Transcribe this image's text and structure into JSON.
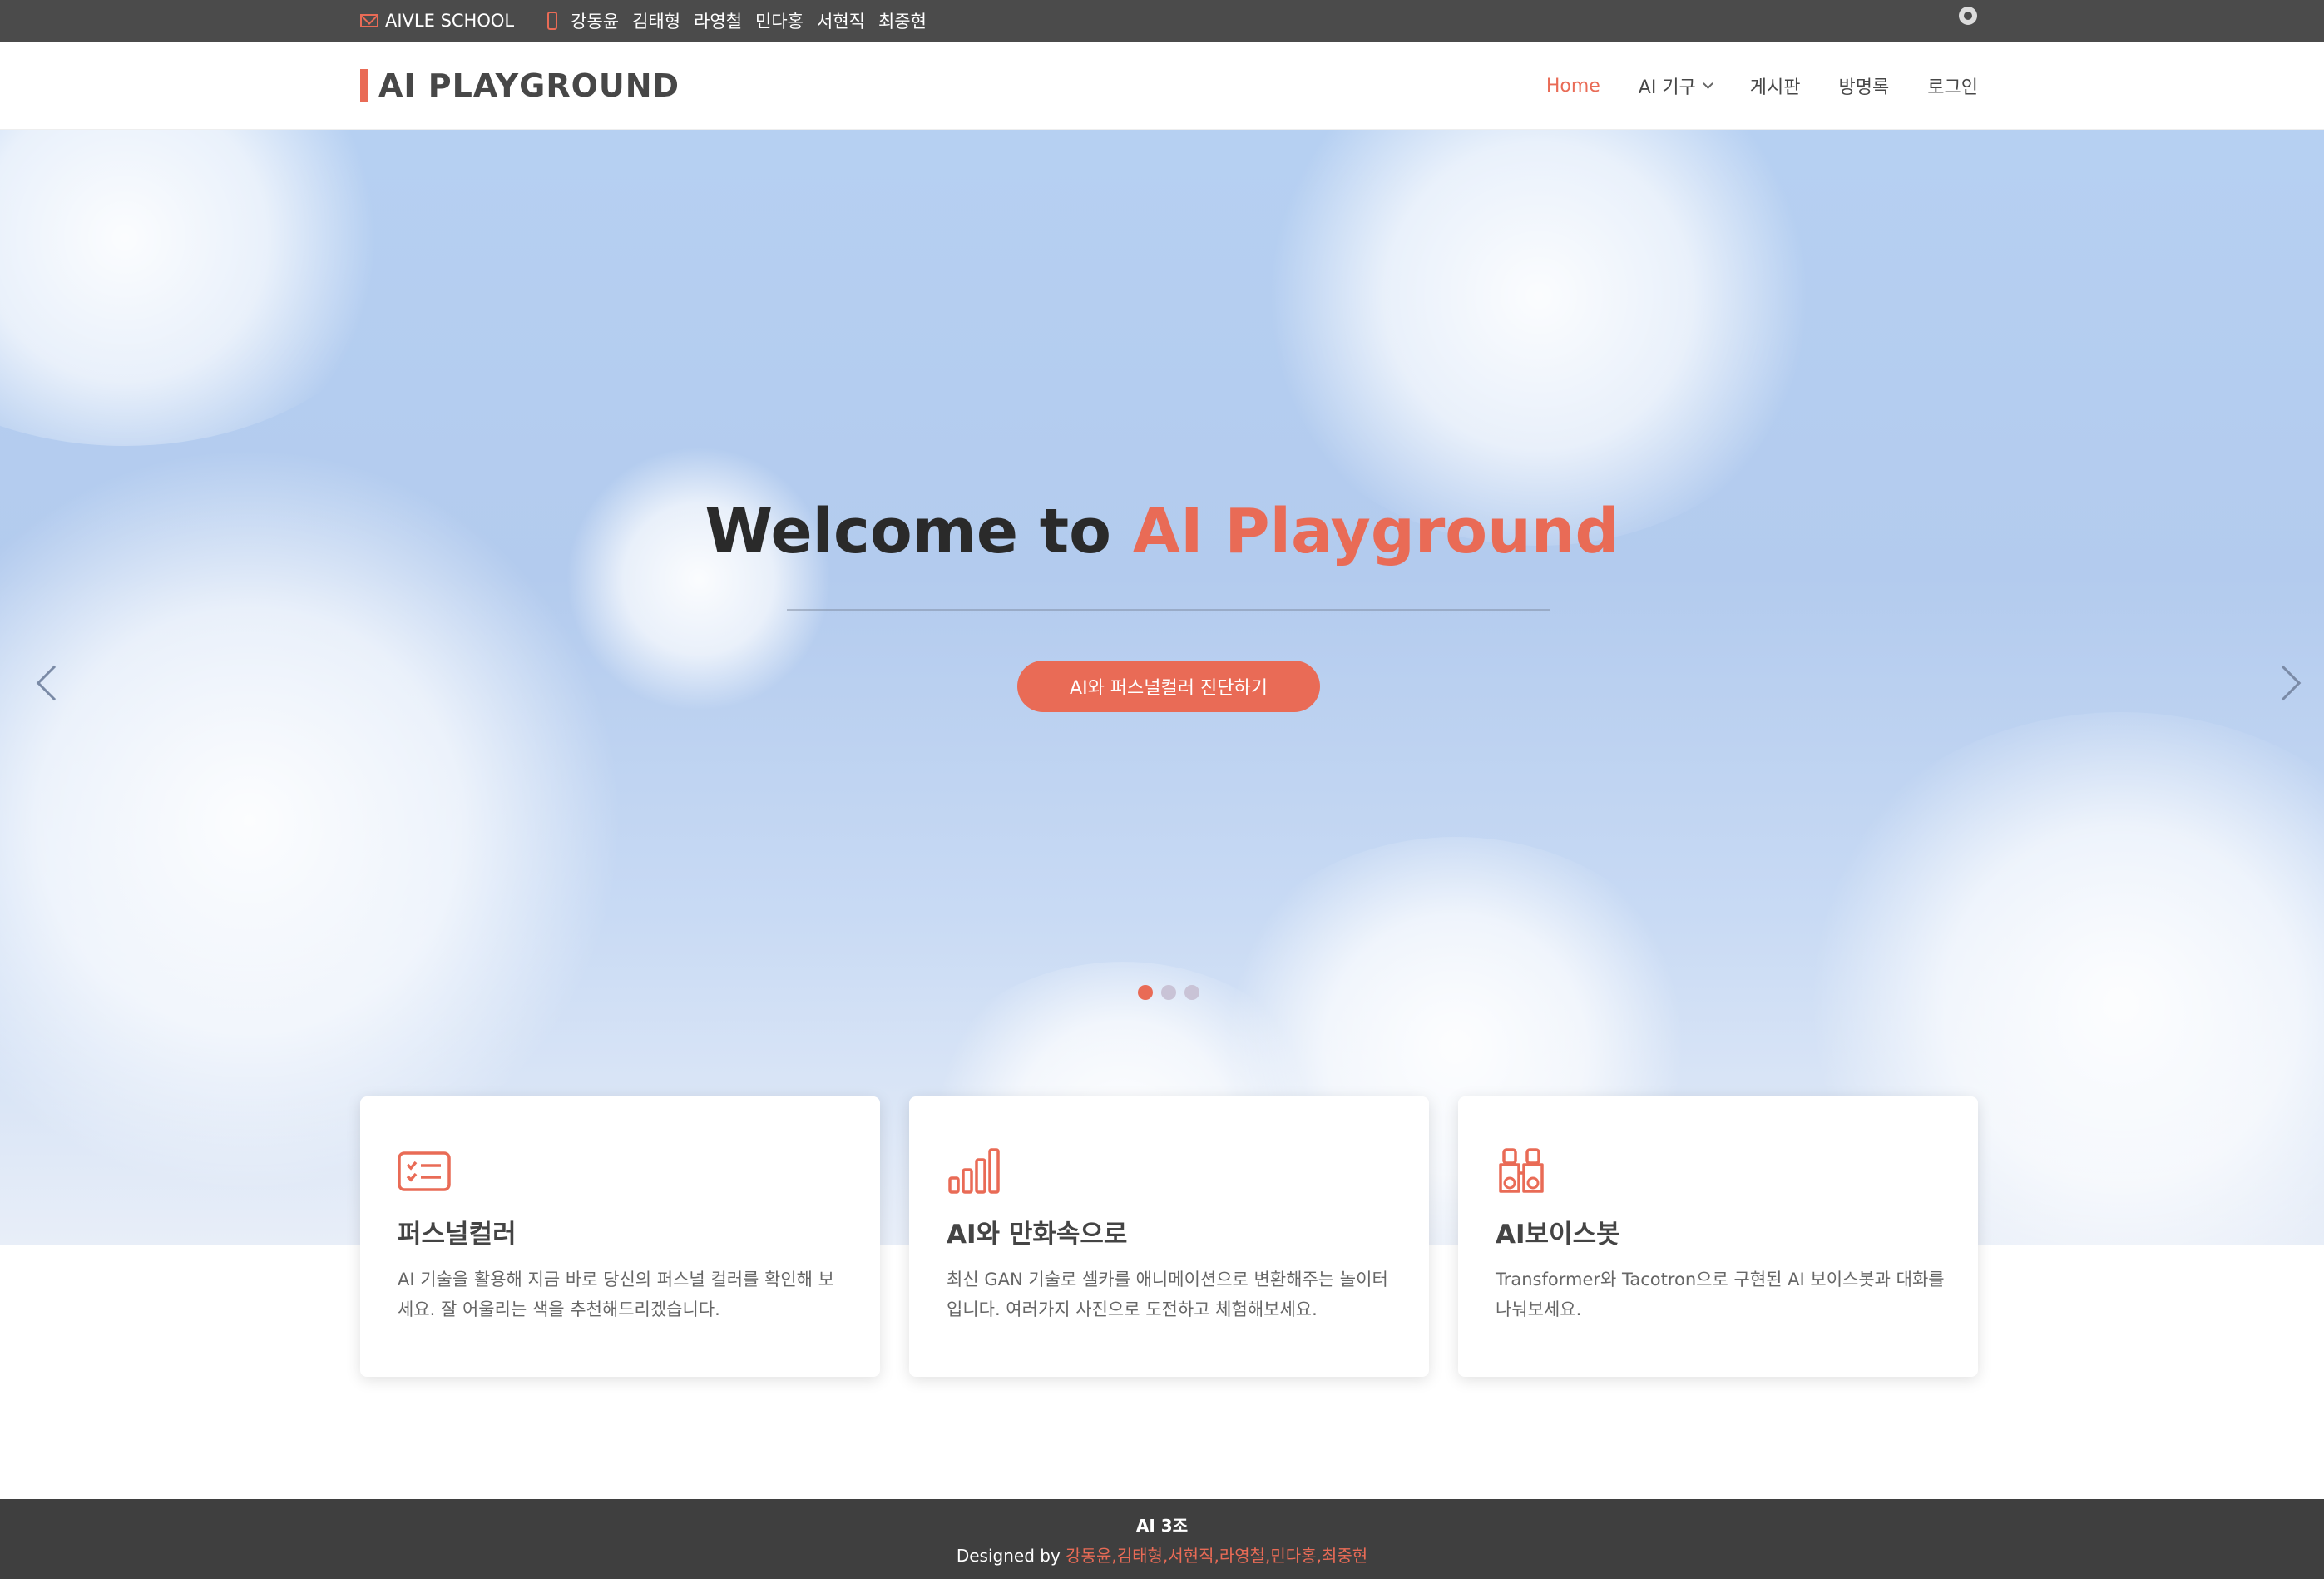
{
  "topbar": {
    "brand": "AIVLE SCHOOL",
    "members": [
      "강동윤",
      "김태형",
      "라영철",
      "민다홍",
      "서현직",
      "최중현"
    ],
    "icons": [
      "envelope-icon",
      "phone-icon",
      "github-icon"
    ]
  },
  "header": {
    "logo": "AI PLAYGROUND",
    "nav": {
      "home": "Home",
      "tools": "AI 기구",
      "board": "게시판",
      "guestbook": "방명록",
      "login": "로그인"
    }
  },
  "hero": {
    "title_prefix": "Welcome to ",
    "title_accent": "AI Playground",
    "cta": "AI와 퍼스널컬러 진단하기",
    "slide_count": 3,
    "active_slide": 1
  },
  "cards": [
    {
      "icon": "checklist-icon",
      "title": "퍼스널컬러",
      "desc": "AI 기술을 활용해 지금 바로 당신의 퍼스널 컬러를 확인해 보세요. 잘 어울리는 색을 추천해드리겠습니다."
    },
    {
      "icon": "bar-chart-icon",
      "title": "AI와 만화속으로",
      "desc": "최신 GAN 기술로 셀카를 애니메이션으로 변환해주는 놀이터입니다. 여러가지 사진으로 도전하고 체험해보세요."
    },
    {
      "icon": "binoculars-icon",
      "title": "AI보이스봇",
      "desc": "Transformer와 Tacotron으로 구현된 AI 보이스봇과 대화를 나눠보세요."
    }
  ],
  "footer": {
    "team": "AI 3조",
    "designed_by_label": "Designed by ",
    "designers": "강동윤,김태형,서현직,라영철,민다홍,최중현"
  },
  "colors": {
    "accent": "#e96b56",
    "topbar": "#4b4b4b",
    "footer": "#3f3f3f"
  }
}
